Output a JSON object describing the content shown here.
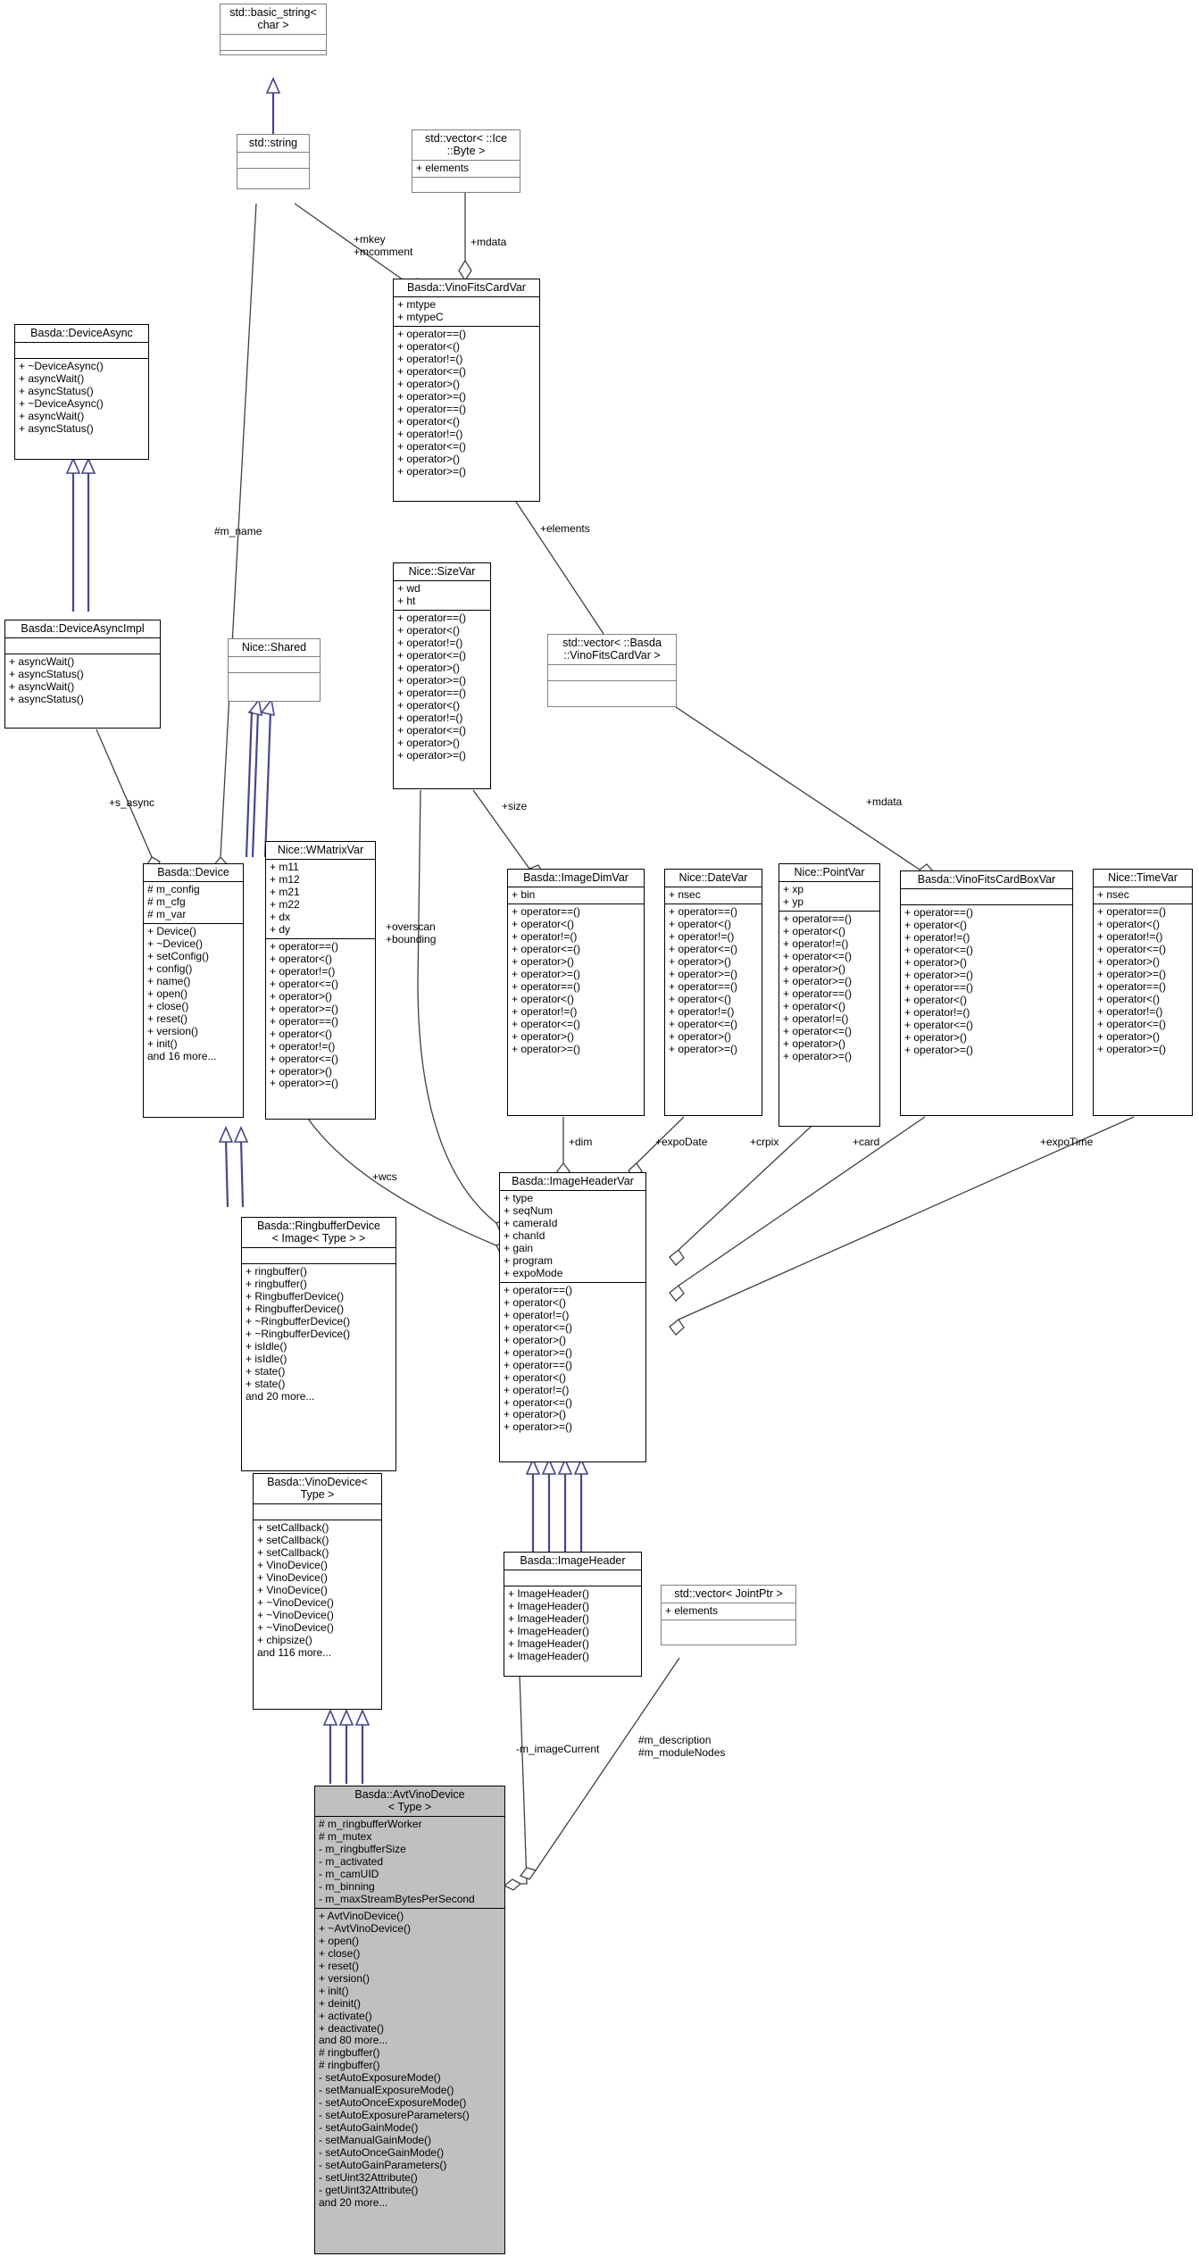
{
  "diagram": {
    "kind": "uml-class-diagram",
    "title": "Basda::AvtVinoDevice< Type > collaboration diagram"
  },
  "nodes": [
    {
      "id": "basic_string",
      "name": "std::basic_string<\nchar >",
      "attrs": "",
      "ops": "",
      "style": "plain"
    },
    {
      "id": "string",
      "name": "std::string",
      "attrs": "",
      "ops": "",
      "style": "plain"
    },
    {
      "id": "vector_ice_byte",
      "name": "std::vector< ::Ice\n::Byte >",
      "attrs": "+ elements",
      "ops": "",
      "style": "plain"
    },
    {
      "id": "vinofitscardvar",
      "name": "Basda::VinoFitsCardVar",
      "attrs": "+ mtype\n+ mtypeC",
      "ops": "+ operator==()\n+ operator<()\n+ operator!=()\n+ operator<=()\n+ operator>()\n+ operator>=()\n+ operator==()\n+ operator<()\n+ operator!=()\n+ operator<=()\n+ operator>()\n+ operator>=()",
      "style": "solid"
    },
    {
      "id": "deviceasync",
      "name": "Basda::DeviceAsync",
      "attrs": "",
      "ops": "+ ~DeviceAsync()\n+ asyncWait()\n+ asyncStatus()\n+ ~DeviceAsync()\n+ asyncWait()\n+ asyncStatus()",
      "style": "solid"
    },
    {
      "id": "deviceasyncimpl",
      "name": "Basda::DeviceAsyncImpl",
      "attrs": "",
      "ops": "+ asyncWait()\n+ asyncStatus()\n+ asyncWait()\n+ asyncStatus()",
      "style": "solid"
    },
    {
      "id": "shared",
      "name": "Nice::Shared",
      "attrs": "",
      "ops": "",
      "style": "plain"
    },
    {
      "id": "sizevar",
      "name": "Nice::SizeVar",
      "attrs": "+ wd\n+ ht",
      "ops": "+ operator==()\n+ operator<()\n+ operator!=()\n+ operator<=()\n+ operator>()\n+ operator>=()\n+ operator==()\n+ operator<()\n+ operator!=()\n+ operator<=()\n+ operator>()\n+ operator>=()",
      "style": "solid"
    },
    {
      "id": "vector_vinofitscardvar",
      "name": "std::vector< ::Basda\n::VinoFitsCardVar >",
      "attrs": "",
      "ops": "",
      "style": "plain"
    },
    {
      "id": "device",
      "name": "Basda::Device",
      "attrs": "# m_config\n# m_cfg\n# m_var",
      "ops": "+ Device()\n+ ~Device()\n+ setConfig()\n+ config()\n+ name()\n+ open()\n+ close()\n+ reset()\n+ version()\n+ init()\nand 16 more...",
      "style": "solid"
    },
    {
      "id": "wmatrixvar",
      "name": "Nice::WMatrixVar",
      "attrs": "+ m11\n+ m12\n+ m21\n+ m22\n+ dx\n+ dy",
      "ops": "+ operator==()\n+ operator<()\n+ operator!=()\n+ operator<=()\n+ operator>()\n+ operator>=()\n+ operator==()\n+ operator<()\n+ operator!=()\n+ operator<=()\n+ operator>()\n+ operator>=()",
      "style": "solid"
    },
    {
      "id": "imagedimvar",
      "name": "Basda::ImageDimVar",
      "attrs": "+ bin",
      "ops": "+ operator==()\n+ operator<()\n+ operator!=()\n+ operator<=()\n+ operator>()\n+ operator>=()\n+ operator==()\n+ operator<()\n+ operator!=()\n+ operator<=()\n+ operator>()\n+ operator>=()",
      "style": "solid"
    },
    {
      "id": "datevar",
      "name": "Nice::DateVar",
      "attrs": "+ nsec",
      "ops": "+ operator==()\n+ operator<()\n+ operator!=()\n+ operator<=()\n+ operator>()\n+ operator>=()\n+ operator==()\n+ operator<()\n+ operator!=()\n+ operator<=()\n+ operator>()\n+ operator>=()",
      "style": "solid"
    },
    {
      "id": "pointvar",
      "name": "Nice::PointVar",
      "attrs": "+ xp\n+ yp",
      "ops": "+ operator==()\n+ operator<()\n+ operator!=()\n+ operator<=()\n+ operator>()\n+ operator>=()\n+ operator==()\n+ operator<()\n+ operator!=()\n+ operator<=()\n+ operator>()\n+ operator>=()",
      "style": "solid"
    },
    {
      "id": "vinofitscardboxvar",
      "name": "Basda::VinoFitsCardBoxVar",
      "attrs": "",
      "ops": "+ operator==()\n+ operator<()\n+ operator!=()\n+ operator<=()\n+ operator>()\n+ operator>=()\n+ operator==()\n+ operator<()\n+ operator!=()\n+ operator<=()\n+ operator>()\n+ operator>=()",
      "style": "solid"
    },
    {
      "id": "timevar",
      "name": "Nice::TimeVar",
      "attrs": "+ nsec",
      "ops": "+ operator==()\n+ operator<()\n+ operator!=()\n+ operator<=()\n+ operator>()\n+ operator>=()\n+ operator==()\n+ operator<()\n+ operator!=()\n+ operator<=()\n+ operator>()\n+ operator>=()",
      "style": "solid"
    },
    {
      "id": "ringbufferdevice",
      "name": "Basda::RingbufferDevice\n< Image< Type > >",
      "attrs": "",
      "ops": "+ ringbuffer()\n+ ringbuffer()\n+ RingbufferDevice()\n+ RingbufferDevice()\n+ ~RingbufferDevice()\n+ ~RingbufferDevice()\n+ isIdle()\n+ isIdle()\n+ state()\n+ state()\nand 20 more...",
      "style": "solid"
    },
    {
      "id": "imageheadervar",
      "name": "Basda::ImageHeaderVar",
      "attrs": "+ type\n+ seqNum\n+ cameraId\n+ chanId\n+ gain\n+ program\n+ expoMode",
      "ops": "+ operator==()\n+ operator<()\n+ operator!=()\n+ operator<=()\n+ operator>()\n+ operator>=()\n+ operator==()\n+ operator<()\n+ operator!=()\n+ operator<=()\n+ operator>()\n+ operator>=()",
      "style": "solid"
    },
    {
      "id": "vinodevice",
      "name": "Basda::VinoDevice<\nType >",
      "attrs": "",
      "ops": "+ setCallback()\n+ setCallback()\n+ setCallback()\n+ VinoDevice()\n+ VinoDevice()\n+ VinoDevice()\n+ ~VinoDevice()\n+ ~VinoDevice()\n+ ~VinoDevice()\n+ chipsize()\nand 116 more...",
      "style": "solid"
    },
    {
      "id": "imageheader",
      "name": "Basda::ImageHeader",
      "attrs": "",
      "ops": "+ ImageHeader()\n+ ImageHeader()\n+ ImageHeader()\n+ ImageHeader()\n+ ImageHeader()\n+ ImageHeader()",
      "style": "solid"
    },
    {
      "id": "vector_jointptr",
      "name": "std::vector< JointPtr >",
      "attrs": "+ elements",
      "ops": "",
      "style": "plain"
    },
    {
      "id": "avtvinodevice",
      "name": "Basda::AvtVinoDevice\n< Type >",
      "attrs": "# m_ringbufferWorker\n# m_mutex\n- m_ringbufferSize\n- m_activated\n- m_camUID\n- m_binning\n- m_maxStreamBytesPerSecond",
      "ops": "+ AvtVinoDevice()\n+ ~AvtVinoDevice()\n+ open()\n+ close()\n+ reset()\n+ version()\n+ init()\n+ deinit()\n+ activate()\n+ deactivate()\nand 80 more...\n# ringbuffer()\n# ringbuffer()\n- setAutoExposureMode()\n- setManualExposureMode()\n- setAutoOnceExposureMode()\n- setAutoExposureParameters()\n- setAutoGainMode()\n- setManualGainMode()\n- setAutoOnceGainMode()\n- setAutoGainParameters()\n- setUint32Attribute()\n- getUint32Attribute()\nand 20 more...",
      "style": "solid-grey"
    }
  ],
  "edge_labels": [
    {
      "id": "mkey",
      "text": "+mkey\n+mcomment"
    },
    {
      "id": "mdata_top",
      "text": "+mdata"
    },
    {
      "id": "m_name",
      "text": "#m_name"
    },
    {
      "id": "elements",
      "text": "+elements"
    },
    {
      "id": "s_async",
      "text": "+s_async"
    },
    {
      "id": "size",
      "text": "+size"
    },
    {
      "id": "mdata_right",
      "text": "+mdata"
    },
    {
      "id": "overscan",
      "text": "+overscan\n+bounding"
    },
    {
      "id": "wcs",
      "text": "+wcs"
    },
    {
      "id": "dim",
      "text": "+dim"
    },
    {
      "id": "expoDate",
      "text": "+expoDate"
    },
    {
      "id": "crpix",
      "text": "+crpix"
    },
    {
      "id": "card",
      "text": "+card"
    },
    {
      "id": "expoTime",
      "text": "+expoTime"
    },
    {
      "id": "m_imageCurrent",
      "text": "-m_imageCurrent"
    },
    {
      "id": "m_description",
      "text": "#m_description\n#m_moduleNodes"
    }
  ],
  "colors": {
    "inheritance_edge": "#46468c",
    "association_edge": "#404040",
    "node_border_solid": "#000000",
    "node_border_plain": "#808080",
    "node_fill": "#ffffff",
    "highlight_fill": "#c0c0c0"
  }
}
